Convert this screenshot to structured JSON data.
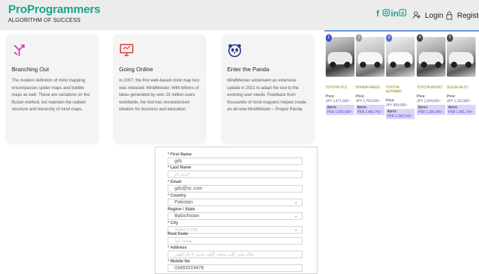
{
  "header": {
    "brand": "ProProgrammers",
    "tagline": "ALGORITHM OF SUCCESS",
    "social_icons": [
      "facebook-icon",
      "instagram-icon",
      "linkedin-icon",
      "skype-icon"
    ],
    "login_label": "Login",
    "register_label": "Register",
    "accent_color": "#1aa58f"
  },
  "cards": [
    {
      "title": "Branching Out",
      "text": "The modern definition of mind mapping encompasses spider maps and bubble maps as well. These are variations on the Buzan method, but maintain the radiant structure and hierarchy of mind maps.",
      "icon": "branch-arrows-icon"
    },
    {
      "title": "Going Online",
      "text": "In 2007, the first web-based mind map tool was released: MindMeister. With billions of ideas generated by over 25 million users worldwide, the tool has revolutionized ideation for business and education.",
      "icon": "monitor-icon"
    },
    {
      "title": "Enter the Panda",
      "text": "MindMeister underwent an extensive update in 2021 to adapt the tool to the evolving user needs. Feedback from thousands of mind mappers helped create an all-new MindMeister – Project Panda.",
      "icon": "panda-icon"
    }
  ],
  "cars": [
    {
      "badge": "1",
      "name": "TOYOTA VITZ",
      "price_label": "Price:",
      "price": "JPY 1,471,000~",
      "approx_label": "Aprox.",
      "approx": "PKR 1,920,000~"
    },
    {
      "badge": "2",
      "name": "HONDA FREED",
      "price_label": "Price:",
      "price": "JPY 1,750,000~",
      "approx_label": "Aprox.",
      "approx": "PKR 2,460,753~"
    },
    {
      "badge": "3",
      "name": "TOYOTA ALPHARD",
      "price_label": "Price:",
      "price": "JPY 990,000~",
      "approx_label": "Aprox.",
      "approx": "PKR 1,392,543~"
    },
    {
      "badge": "4",
      "name": "TOYOTA PASSO",
      "price_label": "Price:",
      "price": "JPY 1,034,000~",
      "approx_label": "Aprox.",
      "approx": "PKR 1,305,495~"
    },
    {
      "badge": "5",
      "name": "SUZUKI ALTO",
      "price_label": "Price:",
      "price": "JPY 1,115,900~",
      "approx_label": "Aprox.",
      "approx": "PKR 1,461,744~"
    }
  ],
  "form": {
    "first_name": {
      "label": "First Name",
      "value": "gds"
    },
    "last_name": {
      "label": "Last Name",
      "placeholder": "اخری نام"
    },
    "email": {
      "label": "Email",
      "value": "gds@sc.com"
    },
    "country": {
      "label": "Country",
      "value": "Pakistan"
    },
    "region": {
      "label": "Region / State",
      "value": "Balochistan"
    },
    "city": {
      "label": "City",
      "value": "Select A City"
    },
    "post_code": {
      "label": "Post Code",
      "placeholder": "پوسٹ کوڈ"
    },
    "address": {
      "label": "Address",
      "placeholder": "مکان نمبر، گلی، محلہ، گاؤں، شہر کا نام لکھیں"
    },
    "mobile": {
      "label": "Mobile No",
      "value": "03492019478"
    }
  }
}
